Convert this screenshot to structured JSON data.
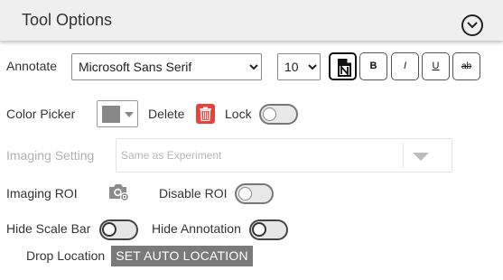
{
  "header": {
    "title": "Tool Options",
    "collapse_icon": "chevron-down-circle-icon"
  },
  "annotate": {
    "label": "Annotate",
    "font_family": "Microsoft Sans Serif",
    "font_size": "10",
    "buttons": {
      "note_icon": "note-new-icon",
      "bold": "B",
      "italic": "I",
      "underline": "U",
      "strike": "ab"
    }
  },
  "color_picker": {
    "label": "Color Picker",
    "color": "#888888"
  },
  "delete": {
    "label": "Delete",
    "icon": "trash-icon",
    "color": "#e8423f"
  },
  "lock": {
    "label": "Lock",
    "on": false
  },
  "imaging_setting": {
    "label": "Imaging Setting",
    "value": "Same as Experiment",
    "disabled": true
  },
  "imaging_roi": {
    "label": "Imaging ROI",
    "icon": "camera-settings-icon"
  },
  "disable_roi": {
    "label": "Disable ROI",
    "on": false
  },
  "hide_scale_bar": {
    "label": "Hide Scale Bar",
    "on": false
  },
  "hide_annotation": {
    "label": "Hide Annotation",
    "on": false
  },
  "drop_location": {
    "label": "Drop Location",
    "button": "SET AUTO LOCATION"
  }
}
